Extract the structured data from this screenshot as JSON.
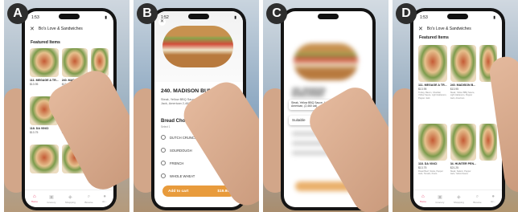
{
  "panels": [
    {
      "label": "A",
      "status_time": "1:53",
      "restaurant": "Bo's Love & Sandwiches",
      "section_title": "Featured Items",
      "items": [
        {
          "title": "111. MEGAGE A TR...",
          "price": "$13.95"
        },
        {
          "title": "240. MADISON...",
          "price": "$13.95"
        },
        {
          "title": "",
          "price": ""
        },
        {
          "title": "118. DA VINCI",
          "price": "$13.75"
        },
        {
          "title": "34. HUNTER PEN...",
          "price": "$11.25"
        },
        {
          "title": "",
          "price": ""
        },
        {
          "title": "",
          "price": ""
        },
        {
          "title": "",
          "price": ""
        },
        {
          "title": "",
          "price": ""
        }
      ],
      "tabs": [
        {
          "icon": "home-icon",
          "label": "Home"
        },
        {
          "icon": "grocery-icon",
          "label": "Grocery"
        },
        {
          "icon": "shopping-icon",
          "label": "Shopping"
        },
        {
          "icon": "browse-icon",
          "label": "Browse"
        },
        {
          "icon": "account-icon",
          "label": "Ac..."
        }
      ]
    },
    {
      "label": "B",
      "status_time": "1:52",
      "item_title": "240. MADISON BUMGARNER",
      "item_desc": "Steak, Yellow BBQ Sauce, Light Habanero Pepper Jack, American 2,460 cal",
      "choice_title": "Bread Choice",
      "choice_sub": "Select 1",
      "options": [
        "DUTCH CRUNCH",
        "SOURDOUGH",
        "FRENCH",
        "WHOLE WHEAT"
      ],
      "add_label": "Add to cart",
      "add_price": "$19.95"
    },
    {
      "label": "C",
      "blur_title": "240. MADISON BUMGARNER",
      "popup_desc": "Steak, Yellow BBQ Sauce, Light Habanero Pepper Jack, American, (2,460 cal)",
      "popup_button": "Suitable"
    },
    {
      "label": "D",
      "status_time": "1:53",
      "restaurant": "Bo's Love & Sandwiches",
      "section_title": "Featured Items",
      "items": [
        {
          "title": "111. MEGAGE A TR...",
          "price": "$13.95",
          "desc": "Turkey, Bacon, Cheddar, Yellow Sauce, Light Habanero, Pepper Jack"
        },
        {
          "title": "240. MADISON B...",
          "price": "$13.95",
          "desc": "Steak, Yellow BBQ Sauce, Light Habanero, Pepper Jack, American"
        },
        {
          "title": "",
          "price": "",
          "desc": ""
        },
        {
          "title": "118. DA VINCI",
          "price": "$13.75",
          "desc": "Roast Beef, Swiss, Pepper Jack, Tomato, Pesto"
        },
        {
          "title": "34. HUNTER PEN...",
          "price": "$21.25",
          "desc": "Steak, Salami, Pepper Jack, Yellow Sauce"
        },
        {
          "title": "",
          "price": "",
          "desc": ""
        }
      ],
      "tabs": [
        {
          "icon": "home-icon",
          "label": "Home"
        },
        {
          "icon": "grocery-icon",
          "label": "Grocery"
        },
        {
          "icon": "shopping-icon",
          "label": "Shopping"
        },
        {
          "icon": "browse-icon",
          "label": "Browse"
        },
        {
          "icon": "account-icon",
          "label": "Ac..."
        }
      ]
    }
  ],
  "colors": {
    "accent": "#e94a6f",
    "cart_button": "#e89b3c",
    "badge": "#2e2e2e"
  }
}
